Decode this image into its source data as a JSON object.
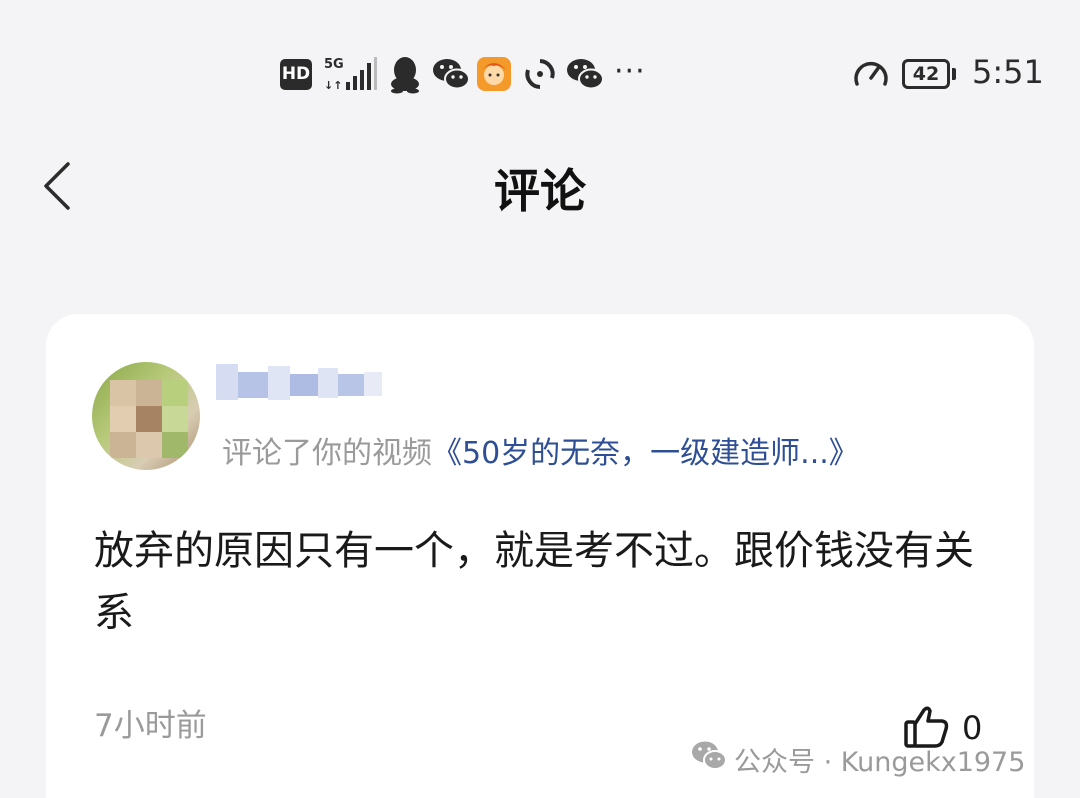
{
  "status_bar": {
    "network_badge": "HD",
    "signal_label": "5G",
    "battery_level": "42",
    "time": "5:51",
    "notification_icons": [
      "qq-icon",
      "wechat-icon",
      "app-avatar-icon",
      "sync-icon",
      "wechat-icon"
    ],
    "more_indicator": "···"
  },
  "header": {
    "title": "评论",
    "back_icon": "chevron-left-icon"
  },
  "comment": {
    "meta_prefix": "评论了你的视频",
    "video_title": "《50岁的无奈，一级建造师...》",
    "text": "放弃的原因只有一个，就是考不过。跟价钱没有关系",
    "time_ago": "7小时前",
    "like_count": "0"
  },
  "watermark": {
    "text": "公众号 · Kungekx1975"
  },
  "colors": {
    "background": "#f4f4f6",
    "card": "#ffffff",
    "link": "#2e4f95",
    "muted": "#9a9a9a"
  }
}
